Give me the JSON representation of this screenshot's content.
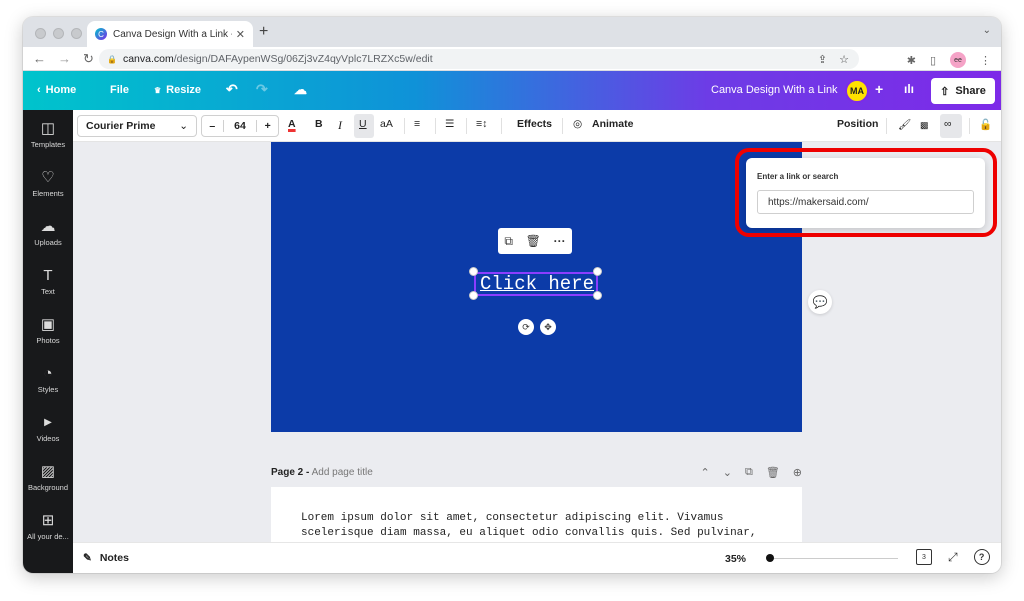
{
  "browser": {
    "tab_title": "Canva Design With a Link - Blo",
    "favicon": "C",
    "url_domain": "canva.com",
    "url_path": "/design/DAFAypenWSg/06Zj3vZ4qyVplc7LRZXc5w/edit",
    "profile": "ee"
  },
  "header": {
    "home": "Home",
    "file": "File",
    "resize": "Resize",
    "doc_title": "Canva Design With a Link",
    "avatar": "MA",
    "share": "Share"
  },
  "sidebar": {
    "items": [
      {
        "label": "Templates",
        "icon": "◫"
      },
      {
        "label": "Elements",
        "icon": "♡"
      },
      {
        "label": "Uploads",
        "icon": "☁"
      },
      {
        "label": "Text",
        "icon": "T"
      },
      {
        "label": "Photos",
        "icon": "▣"
      },
      {
        "label": "Styles",
        "icon": "◔"
      },
      {
        "label": "Videos",
        "icon": "▶"
      },
      {
        "label": "Background",
        "icon": "▨"
      },
      {
        "label": "All your de...",
        "icon": "⊞"
      }
    ]
  },
  "toolbar": {
    "font": "Courier Prime",
    "font_size": "64",
    "minus": "–",
    "plus": "+",
    "bold": "B",
    "italic": "I",
    "underline": "U",
    "case": "aA",
    "effects": "Effects",
    "animate": "Animate",
    "position": "Position"
  },
  "canvas": {
    "selected_text": "Click here",
    "page_color": "#0c3ba8"
  },
  "page2": {
    "label": "Page 2 -",
    "title_placeholder": "Add page title",
    "body": "Lorem ipsum dolor sit amet, consectetur adipiscing elit. Vivamus\nscelerisque diam massa, eu aliquet odio convallis quis. Sed pulvinar,\nligula in varius varius, nisi justo congue sapien, ac iaculis lacus dui\nid odio. Nullam molestie posuere ... Nam sit amet erat ac risus"
  },
  "link_popup": {
    "label": "Enter a link or search",
    "value": "https://makersaid.com/"
  },
  "footer": {
    "notes": "Notes",
    "zoom": "35%",
    "zoom_fraction": 0.35,
    "page_count": "3",
    "help": "?"
  },
  "colors": {
    "accent_purple": "#7d2ae8",
    "accent_teal": "#00c4cc",
    "highlight_red": "#ee0000"
  }
}
